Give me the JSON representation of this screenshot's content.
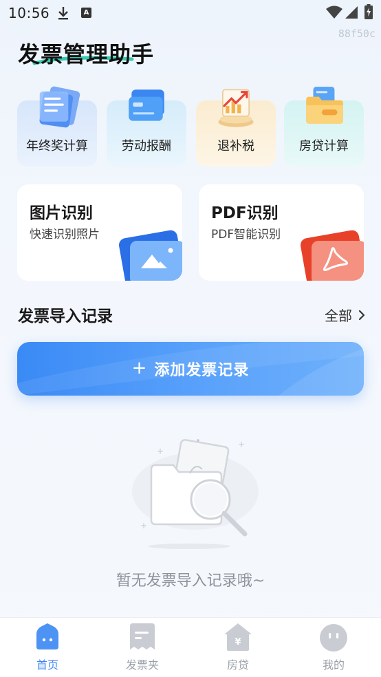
{
  "status_bar": {
    "time": "10:56",
    "a_badge": "A"
  },
  "debug_code": "88f50c",
  "app_title": "发票管理助手",
  "tools": [
    {
      "label": "年终奖计算",
      "icon": "document-stack-icon"
    },
    {
      "label": "劳动报酬",
      "icon": "card-icon"
    },
    {
      "label": "退补税",
      "icon": "trend-chart-icon"
    },
    {
      "label": "房贷计算",
      "icon": "folder-icon"
    }
  ],
  "recognition": {
    "image": {
      "title": "图片识别",
      "subtitle": "快速识别照片",
      "icon": "image-icon"
    },
    "pdf": {
      "title": "PDF识别",
      "subtitle": "PDF智能识别",
      "icon": "pdf-icon"
    }
  },
  "section": {
    "title": "发票导入记录",
    "see_all": "全部"
  },
  "add_button": {
    "plus": "+",
    "label": "添加发票记录"
  },
  "empty_state": {
    "text": "暂无发票导入记录哦~"
  },
  "nav": [
    {
      "label": "首页",
      "icon": "home-icon",
      "active": true
    },
    {
      "label": "发票夹",
      "icon": "invoice-folder-icon",
      "active": false
    },
    {
      "label": "房贷",
      "icon": "house-icon",
      "active": false
    },
    {
      "label": "我的",
      "icon": "profile-icon",
      "active": false
    }
  ],
  "colors": {
    "accent": "#3d86f0",
    "button_start": "#3a8af6",
    "button_end": "#6eb0fb"
  }
}
